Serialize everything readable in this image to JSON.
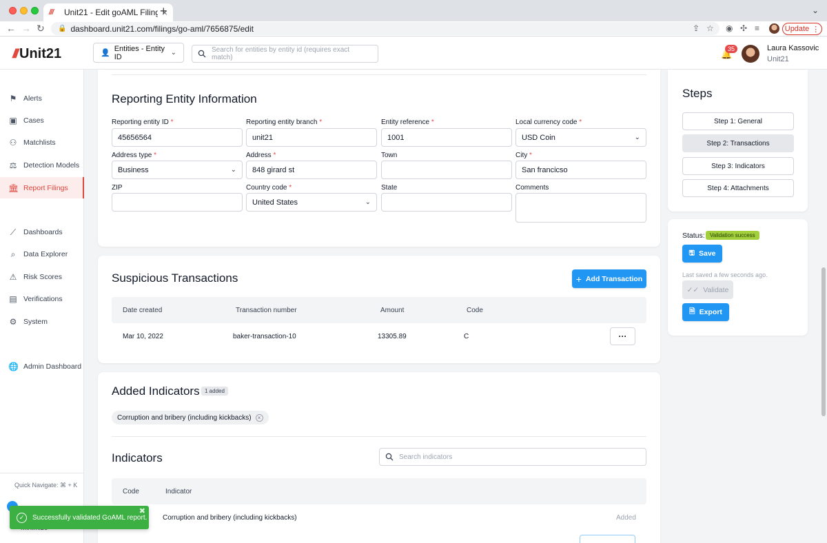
{
  "browser": {
    "tab_title": "Unit21 - Edit goAML Filing",
    "url": "dashboard.unit21.com/filings/go-aml/7656875/edit",
    "update_label": "Update"
  },
  "header": {
    "logo_text": "Unit21",
    "entity_select": "Entities - Entity ID",
    "search_placeholder": "Search for entities by entity id (requires exact match)",
    "notification_count": "35",
    "user_name": "Laura Kassovic",
    "user_org": "Unit21"
  },
  "sidebar": {
    "items": [
      {
        "label": "Alerts",
        "icon": "flag-icon"
      },
      {
        "label": "Cases",
        "icon": "briefcase-icon"
      },
      {
        "label": "Matchlists",
        "icon": "user-plus-icon"
      },
      {
        "label": "Detection Models",
        "icon": "scale-icon"
      },
      {
        "label": "Report Filings",
        "icon": "bank-icon"
      },
      {
        "label": "Dashboards",
        "icon": "chart-line-icon"
      },
      {
        "label": "Data Explorer",
        "icon": "data-search-icon"
      },
      {
        "label": "Risk Scores",
        "icon": "warning-icon"
      },
      {
        "label": "Verifications",
        "icon": "id-card-icon"
      },
      {
        "label": "System",
        "icon": "gear-icon"
      },
      {
        "label": "Admin Dashboard",
        "icon": "globe-icon"
      }
    ],
    "quick_navigate": "Quick Navigate: ⌘ + K",
    "minimize": "Minimize"
  },
  "reporting_entity": {
    "title": "Reporting Entity Information",
    "fields": {
      "entity_id": {
        "label": "Reporting entity ID",
        "value": "45656564"
      },
      "branch": {
        "label": "Reporting entity branch",
        "value": "unit21"
      },
      "reference": {
        "label": "Entity reference",
        "value": "1001"
      },
      "currency": {
        "label": "Local currency code",
        "value": "USD Coin"
      },
      "address_type": {
        "label": "Address type",
        "value": "Business"
      },
      "address": {
        "label": "Address",
        "value": "848 girard st"
      },
      "town": {
        "label": "Town",
        "value": ""
      },
      "city": {
        "label": "City",
        "value": "San francicso"
      },
      "zip": {
        "label": "ZIP",
        "value": ""
      },
      "country": {
        "label": "Country code",
        "value": "United States"
      },
      "state": {
        "label": "State",
        "value": ""
      },
      "comments": {
        "label": "Comments",
        "value": ""
      }
    }
  },
  "transactions": {
    "title": "Suspicious Transactions",
    "add_label": "Add Transaction",
    "columns": [
      "Date created",
      "Transaction number",
      "Amount",
      "Code"
    ],
    "rows": [
      {
        "date": "Mar 10, 2022",
        "number": "baker-transaction-10",
        "amount": "13305.89",
        "code": "C"
      }
    ]
  },
  "added_indicators": {
    "title": "Added Indicators",
    "count": "1 added",
    "chips": [
      "Corruption and bribery (including kickbacks)"
    ]
  },
  "indicators": {
    "title": "Indicators",
    "search_placeholder": "Search indicators",
    "columns": [
      "Code",
      "Indicator"
    ],
    "rows": [
      {
        "indicator": "Corruption and bribery (including kickbacks)",
        "status": "Added"
      }
    ]
  },
  "steps": {
    "title": "Steps",
    "items": [
      "Step 1: General",
      "Step 2: Transactions",
      "Step 3: Indicators",
      "Step 4: Attachments"
    ]
  },
  "status_panel": {
    "status_label": "Status:",
    "status_value": "Validation success",
    "save_label": "Save",
    "last_saved": "Last saved a few seconds ago.",
    "validate_label": "Validate",
    "export_label": "Export"
  },
  "toast": {
    "message": "Successfully validated GoAML report."
  },
  "colors": {
    "brand": "#e0453a",
    "primary": "#2196f3",
    "success": "#3cb043"
  }
}
